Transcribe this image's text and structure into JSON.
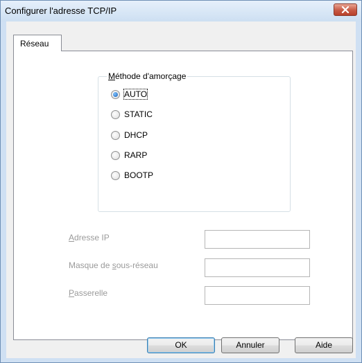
{
  "window": {
    "title": "Configurer l'adresse TCP/IP"
  },
  "tabs": [
    {
      "label": "Réseau",
      "active": true
    }
  ],
  "boot_method": {
    "legend": "Méthode d'amorçage",
    "options": [
      {
        "label": "AUTO",
        "checked": true
      },
      {
        "label": "STATIC",
        "checked": false
      },
      {
        "label": "DHCP",
        "checked": false
      },
      {
        "label": "RARP",
        "checked": false
      },
      {
        "label": "BOOTP",
        "checked": false
      }
    ]
  },
  "fields": [
    {
      "label": "Adresse IP",
      "value": ""
    },
    {
      "label": "Masque de sous-réseau",
      "value": ""
    },
    {
      "label": "Passerelle",
      "value": ""
    }
  ],
  "buttons": {
    "ok": "OK",
    "cancel": "Annuler",
    "help": "Aide"
  },
  "colors": {
    "titlebar": "#cddff2",
    "disabled_text": "#9a9a9a",
    "close": "#c75a45"
  }
}
